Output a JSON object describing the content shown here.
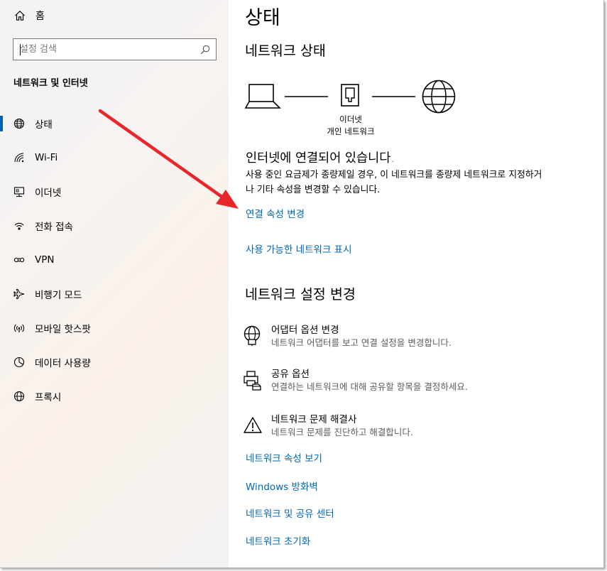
{
  "sidebar": {
    "home_label": "홈",
    "search_placeholder": "설정 검색",
    "section_title": "네트워크 및 인터넷",
    "items": [
      {
        "label": "상태",
        "icon": "globe-status-icon",
        "active": true
      },
      {
        "label": "Wi-Fi",
        "icon": "wifi-icon"
      },
      {
        "label": "이더넷",
        "icon": "ethernet-icon"
      },
      {
        "label": "전화 접속",
        "icon": "dial-up-icon"
      },
      {
        "label": "VPN",
        "icon": "vpn-icon"
      },
      {
        "label": "비행기 모드",
        "icon": "airplane-icon"
      },
      {
        "label": "모바일 핫스팟",
        "icon": "hotspot-icon"
      },
      {
        "label": "데이터 사용량",
        "icon": "data-usage-icon"
      },
      {
        "label": "프록시",
        "icon": "proxy-globe-icon"
      }
    ]
  },
  "main": {
    "page_title": "상태",
    "network_status_heading": "네트워크 상태",
    "diagram": {
      "adapter_label": "이더넷",
      "network_label": "개인 네트워크"
    },
    "connected_text": "인터넷에 연결되어 있습니다.",
    "description": "사용 중인 요금제가 종량제일 경우, 이 네트워크를 종량제 네트워크로 지정하거나 기타 속성을 변경할 수 있습니다.",
    "change_properties_link": "연결 속성 변경",
    "show_networks_link": "사용 가능한 네트워크 표시",
    "change_settings_heading": "네트워크 설정 변경",
    "options": [
      {
        "title": "어댑터 옵션 변경",
        "subtitle": "네트워크 어댑터를 보고 연결 설정을 변경합니다.",
        "icon": "adapter-globe-icon"
      },
      {
        "title": "공유 옵션",
        "subtitle": "연결하는 네트워크에 대해 공유할 항목을 결정하세요.",
        "icon": "sharing-printer-icon"
      },
      {
        "title": "네트워크 문제 해결사",
        "subtitle": "네트워크 문제를 진단하고 해결합니다.",
        "icon": "warning-triangle-icon"
      }
    ],
    "links": [
      "네트워크 속성 보기",
      "Windows 방화벽",
      "네트워크 및 공유 센터",
      "네트워크 초기화"
    ]
  },
  "colors": {
    "accent": "#0063b1",
    "link": "#0067b8",
    "annotation_arrow": "#e8262a"
  }
}
